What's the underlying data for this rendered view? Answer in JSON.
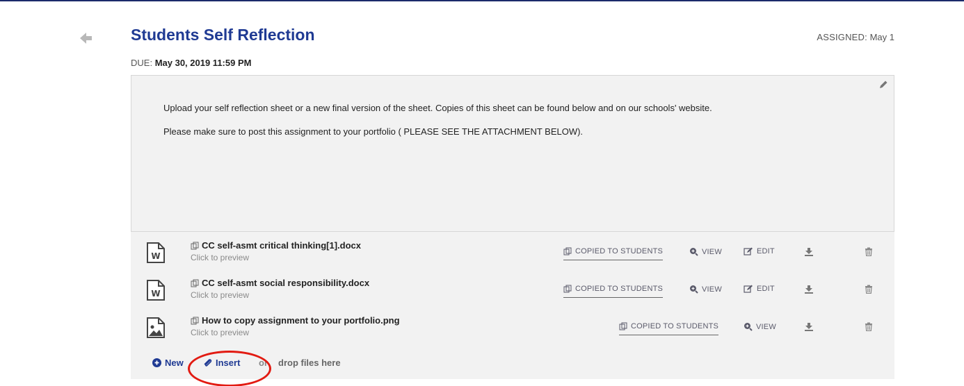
{
  "assignment": {
    "title": "Students Self Reflection",
    "assigned_label": "ASSIGNED:",
    "assigned_value": "May 1",
    "due_label": "DUE:",
    "due_value": "May 30, 2019 11:59 PM"
  },
  "description": {
    "line1": "Upload your self reflection sheet or a new final version of the sheet. Copies of this sheet can be found below and on our schools' website.",
    "line2": "Please make sure to post this assignment to your portfolio ( PLEASE SEE THE ATTACHMENT BELOW)."
  },
  "files": [
    {
      "name": "CC self-asmt critical thinking[1].docx",
      "preview": "Click to preview",
      "type": "word-icon"
    },
    {
      "name": "CC self-asmt social responsibility.docx",
      "preview": "Click to preview",
      "type": "word-icon"
    },
    {
      "name": "How to copy assignment to your portfolio.png",
      "preview": "Click to preview",
      "type": "image-icon"
    }
  ],
  "actions": {
    "copied": "COPIED TO STUDENTS",
    "view": "VIEW",
    "edit": "EDIT"
  },
  "footer": {
    "new_label": "New",
    "insert_label": "Insert",
    "or_label": "or",
    "drop_label": "drop files here"
  },
  "colors": {
    "title": "#1f3a93",
    "panel_bg": "#f2f2f2",
    "highlight": "#e21b12"
  }
}
